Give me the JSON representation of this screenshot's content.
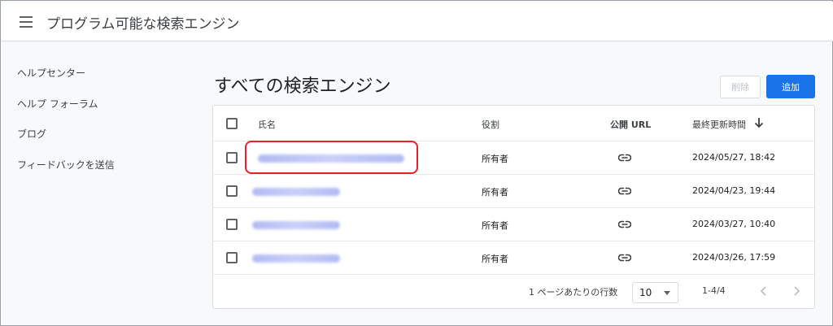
{
  "header": {
    "app_title": "プログラム可能な検索エンジン",
    "menu_icon": "menu-icon"
  },
  "sidebar": {
    "items": [
      {
        "label": "ヘルプセンター"
      },
      {
        "label": "ヘルプ フォーラム"
      },
      {
        "label": "ブログ"
      },
      {
        "label": "フィードバックを送信"
      }
    ]
  },
  "main": {
    "heading": "すべての検索エンジン",
    "delete_label": "削除",
    "add_label": "追加"
  },
  "table": {
    "columns": {
      "name": "氏名",
      "role": "役割",
      "public_url": "公開 URL",
      "updated": "最終更新時間"
    },
    "rows": [
      {
        "role": "所有者",
        "updated": "2024/05/27, 18:42",
        "link_icon": "link-icon"
      },
      {
        "role": "所有者",
        "updated": "2024/04/23, 19:44",
        "link_icon": "link-icon"
      },
      {
        "role": "所有者",
        "updated": "2024/03/27, 10:40",
        "link_icon": "link-icon"
      },
      {
        "role": "所有者",
        "updated": "2024/03/26, 17:59",
        "link_icon": "link-icon"
      }
    ]
  },
  "pagination": {
    "rows_per_page_label": "1 ページあたりの行数",
    "rows_per_page_value": "10",
    "range": "1-4/4"
  },
  "colors": {
    "accent": "#1a73e8",
    "highlight": "#e8202a"
  }
}
